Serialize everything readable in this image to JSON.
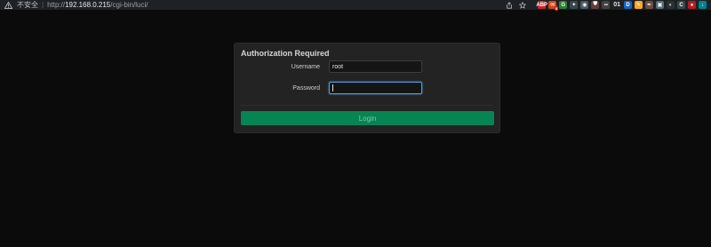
{
  "browser": {
    "security_label": "不安全",
    "separator": "|",
    "url_scheme": "http://",
    "url_host": "192.168.0.215",
    "url_path": "/cgi-bin/luci/",
    "address_actions": [
      "share-icon",
      "bookmark-star-icon"
    ],
    "extensions": [
      {
        "icon": "adblock-icon",
        "text": "ABP",
        "color": "#c62828"
      },
      {
        "icon": "mail-icon",
        "text": "✉",
        "color": "#d84315",
        "badge": "8"
      },
      {
        "icon": "grammar-icon",
        "text": "G",
        "color": "#2e7d32"
      },
      {
        "icon": "translate-icon",
        "text": "✦",
        "color": "#37474f"
      },
      {
        "icon": "camera-icon",
        "text": "◉",
        "color": "#455a64"
      },
      {
        "icon": "shield-icon",
        "text": "⛊",
        "color": "#5d4037"
      },
      {
        "icon": "tampermonkey-icon",
        "text": "▪▪",
        "color": "#424242"
      },
      {
        "icon": "counter-icon",
        "text": "01",
        "color": "transparent"
      },
      {
        "icon": "dictionary-icon",
        "text": "D",
        "color": "#1565c0"
      },
      {
        "icon": "notes-icon",
        "text": "✎",
        "color": "#f9a825"
      },
      {
        "icon": "pen-icon",
        "text": "✒",
        "color": "#6d4c41"
      },
      {
        "icon": "capture-icon",
        "text": "▣",
        "color": "#546e7a"
      },
      {
        "icon": "dark-mode-icon",
        "text": "◐",
        "color": "#263238"
      },
      {
        "icon": "loading-icon",
        "text": "C",
        "color": "#37474f"
      },
      {
        "icon": "record-icon",
        "text": "●",
        "color": "#b71c1c"
      },
      {
        "icon": "download-icon",
        "text": "↓",
        "color": "#00838f"
      }
    ]
  },
  "login": {
    "title": "Authorization Required",
    "username_label": "Username",
    "username_value": "root",
    "password_label": "Password",
    "password_value": "",
    "login_button_label": "Login"
  },
  "colors": {
    "page_background": "#0b0b0b",
    "panel_background": "#232323",
    "button_background": "#078453",
    "button_text": "#7dc9a6",
    "focus_border": "#5aa0d8"
  }
}
